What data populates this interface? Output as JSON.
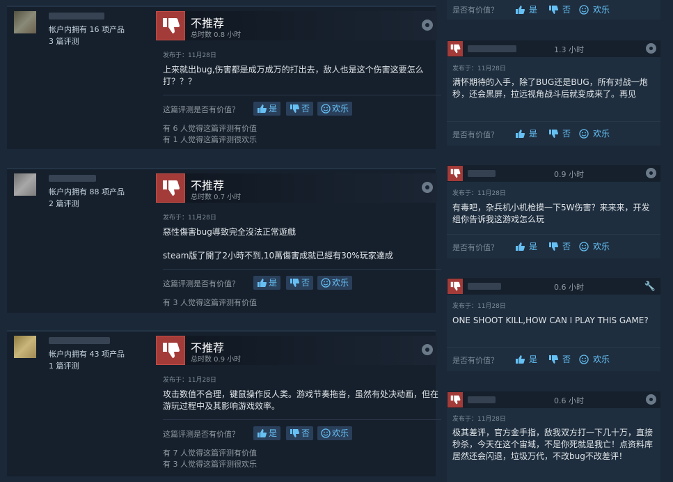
{
  "labels": {
    "not_recommended": "不推荐",
    "helpful_q": "这篇评测是否有价值？",
    "r_helpful_q": "是否有价值？",
    "yes": "是",
    "no": "否",
    "funny": "欢乐"
  },
  "left_reviews": [
    {
      "owned": "帐户内拥有 16 项产品",
      "reviews": "3 篇评测",
      "hours": "总时数 0.8 小时",
      "posted": "发布于：11月28日",
      "body": [
        "上来就出bug,伤害都是成万成万的打出去，敌人也是这个伤害这要怎么打？？？"
      ],
      "stats": [
        "有 6 人觉得这篇评测有价值",
        "有 1 人觉得这篇评测很欢乐"
      ]
    },
    {
      "owned": "帐户内拥有 88 项产品",
      "reviews": "2 篇评测",
      "hours": "总时数 0.7 小时",
      "posted": "发布于：11月28日",
      "body": [
        "惡性傷害bug導致完全沒法正常遊戲",
        "steam版了開了2小時不到,10萬傷害成就已經有30%玩家達成"
      ],
      "stats": [
        "有 3 人觉得这篇评测有价值"
      ]
    },
    {
      "owned": "帐户内拥有 43 项产品",
      "reviews": "1 篇评测",
      "hours": "总时数 0.9 小时",
      "posted": "发布于：11月28日",
      "body": [
        "攻击数值不合理，键鼠操作反人类。游戏节奏拖沓，虽然有处决动画，但在游玩过程中及其影响游戏效率。"
      ],
      "stats": [
        "有 7 人觉得这篇评测有价值",
        "有 3 人觉得这篇评测很欢乐"
      ]
    }
  ],
  "right_reviews": [
    {
      "hours": "1.3 小时",
      "posted": "发布于：11月28日",
      "body": "满怀期待的入手，除了BUG还是BUG，所有对战一炮秒，还会黑屏，拉远视角战斗后就变成来了。再见",
      "icon": "steam-icon"
    },
    {
      "hours": "0.9 小时",
      "posted": "发布于：11月28日",
      "body": "有毒吧，杂兵机小机枪摸一下5W伤害？来来来，开发组你告诉我这游戏怎么玩",
      "icon": "steam-icon"
    },
    {
      "hours": "0.6 小时",
      "posted": "发布于：11月28日",
      "body": "ONE SHOOT KILL,HOW CAN I PLAY THIS GAME?",
      "icon": "wrench-icon"
    },
    {
      "hours": "0.6 小时",
      "posted": "发布于：11月28日",
      "body": "极其差评，官方金手指，敌我双方打一下几十万，直接秒杀，今天在这个宙域，不是你死就是我亡！点资料库居然还会闪退，垃圾万代，不改bug不改差评！",
      "icon": "steam-icon"
    }
  ],
  "colors": {
    "background": "#1b2838",
    "card": "#16202d",
    "thumb_red": "#a33b38",
    "link_blue": "#66c0f4"
  }
}
